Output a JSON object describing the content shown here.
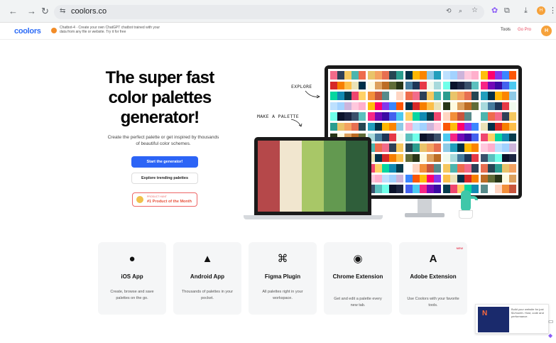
{
  "browser": {
    "url": "coolors.co",
    "back_icon": "←",
    "forward_icon": "→",
    "reload_icon": "↻",
    "site_info_icon": "⇆",
    "toolbar_icons": [
      "translate-icon",
      "zoom-icon",
      "star-icon",
      "extension-icon",
      "puzzle-icon",
      "download-icon"
    ],
    "menu_icon": "⋮"
  },
  "site": {
    "logo": "coolors",
    "promo_text": "Chatbot-4 · Create your own ChatGPT chatbot trained with your data from any file or website. Try it for free",
    "nav_tools": "Tools",
    "nav_gopro": "Go Pro",
    "avatar_letter": "H"
  },
  "hero": {
    "title": "The super fast color palettes generator!",
    "subtitle": "Create the perfect palette or get inspired by thousands of beautiful color schemes.",
    "primary_button": "Start the generator!",
    "secondary_button": "Explore trending palettes",
    "badge_kicker": "PRODUCT HUNT",
    "badge_label": "#1 Product of the Month",
    "annotation_explore": "EXPLORE",
    "annotation_make": "MAKE A PALETTE"
  },
  "laptop_palette": [
    "#b5484a",
    "#f1e6cf",
    "#a8c767",
    "#639950",
    "#2f5e3a"
  ],
  "monitor_palettes": [
    [
      "#f26b8a",
      "#2e4057",
      "#f6c85f",
      "#4cb5ae",
      "#ee6c4d"
    ],
    [
      "#2a9d8f",
      "#e9c46a",
      "#f4a261",
      "#e76f51",
      "#264653"
    ],
    [
      "#8ecae6",
      "#219ebc",
      "#023047",
      "#ffb703",
      "#fb8500"
    ],
    [
      "#cdb4db",
      "#ffc8dd",
      "#ffafcc",
      "#bde0fe",
      "#a2d2ff"
    ],
    [
      "#ff006e",
      "#8338ec",
      "#3a86ff",
      "#fb5607",
      "#ffbe0b"
    ],
    [
      "#003049",
      "#d62828",
      "#f77f00",
      "#fcbf49",
      "#eae2b7"
    ],
    [
      "#606c38",
      "#283618",
      "#fefae0",
      "#dda15e",
      "#bc6c25"
    ],
    [
      "#e63946",
      "#f1faee",
      "#a8dadc",
      "#457b9d",
      "#1d3557"
    ],
    [
      "#0b132b",
      "#1c2541",
      "#3a506b",
      "#5bc0be",
      "#6fffe9"
    ],
    [
      "#f72585",
      "#7209b7",
      "#3a0ca3",
      "#4361ee",
      "#4cc9f0"
    ],
    [
      "#ef476f",
      "#ffd166",
      "#06d6a0",
      "#118ab2",
      "#073b4c"
    ],
    [
      "#588b8b",
      "#ffffff",
      "#ffd5c2",
      "#f28f3b",
      "#c8553d"
    ]
  ],
  "cards": [
    {
      "icon": "",
      "title": "iOS App",
      "desc": "Create, browse and save palettes on the go."
    },
    {
      "icon": "🤖",
      "title": "Android App",
      "desc": "Thousands of palettes in your pocket."
    },
    {
      "icon": "⌘",
      "title": "Figma Plugin",
      "desc": "All palettes right in your workspace."
    },
    {
      "icon": "◉",
      "title": "Chrome Extension",
      "desc": "Get and edit a palette every new tab."
    },
    {
      "icon": "A",
      "title": "Adobe Extension",
      "desc": "Use Coolors with your favorite tools.",
      "new": "NEW"
    }
  ],
  "ad": {
    "text": "Build your website for just $1/month. Host, code and performance."
  },
  "colors": {
    "accent": "#2c64f6",
    "brand_red": "#e84a5f"
  }
}
